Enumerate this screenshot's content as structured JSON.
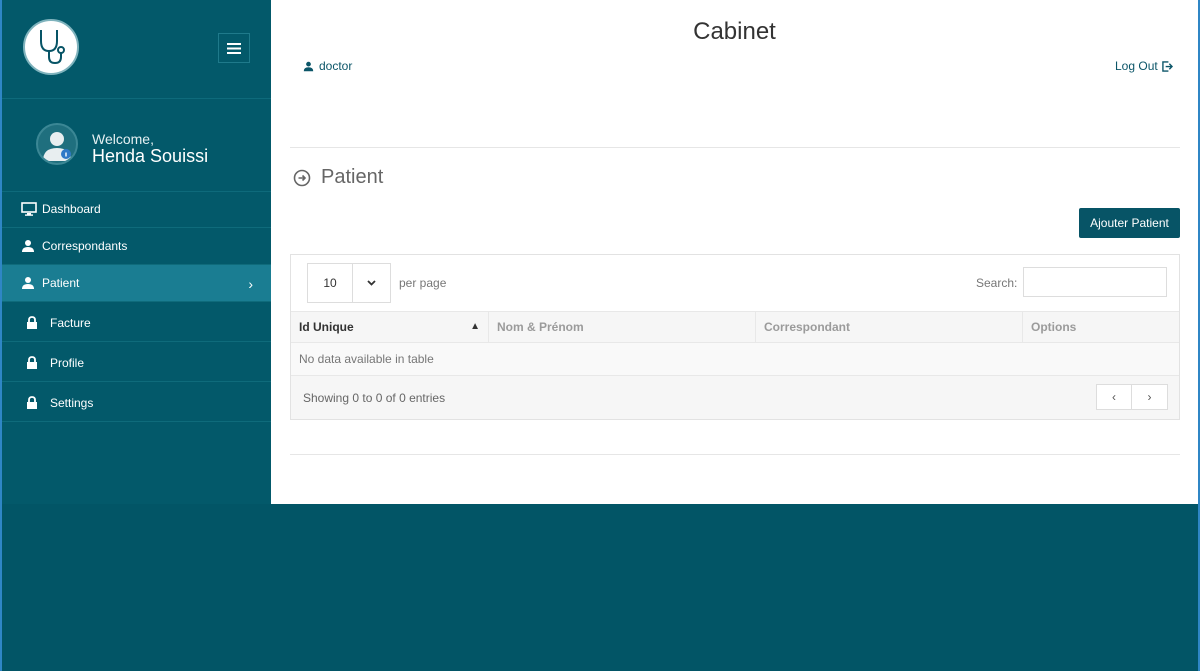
{
  "colors": {
    "sidebar": "#03596a",
    "active": "#1a7d92",
    "accent": "#075466",
    "background": "#025566"
  },
  "app": {
    "title": "Cabinet"
  },
  "header": {
    "user_label": "doctor",
    "logout_label": "Log Out"
  },
  "sidebar": {
    "welcome": "Welcome,",
    "user_name": "Henda Souissi",
    "items": [
      {
        "label": "Dashboard",
        "icon": "monitor-icon"
      },
      {
        "label": "Correspondants",
        "icon": "user-icon"
      },
      {
        "label": "Patient",
        "icon": "user-icon",
        "active": true
      },
      {
        "label": "Facture",
        "icon": "lock-icon"
      },
      {
        "label": "Profile",
        "icon": "lock-icon"
      },
      {
        "label": "Settings",
        "icon": "lock-icon"
      }
    ]
  },
  "page": {
    "section_title": "Patient",
    "add_button": "Ajouter Patient"
  },
  "table": {
    "per_page_value": "10",
    "per_page_label": "per page",
    "search_label": "Search:",
    "columns": [
      "Id Unique",
      "Nom & Prénom",
      "Correspondant",
      "Options"
    ],
    "empty_text": "No data available in table",
    "showing": "Showing 0 to 0 of 0 entries",
    "prev": "‹",
    "next": "›"
  }
}
